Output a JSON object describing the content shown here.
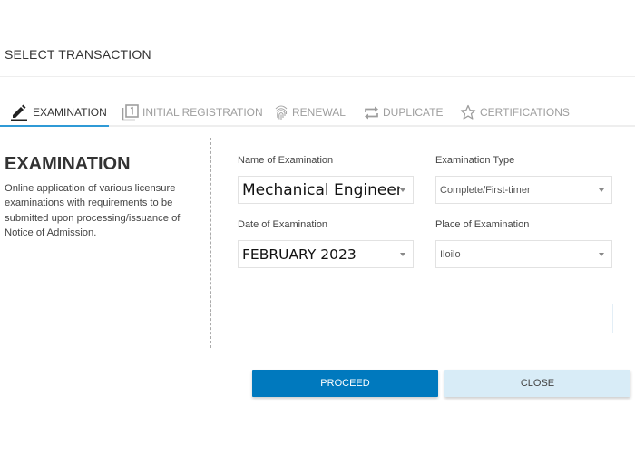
{
  "header": {
    "title": "SELECT TRANSACTION"
  },
  "tabs": [
    {
      "label": "EXAMINATION",
      "icon": "pencil-icon",
      "active": true
    },
    {
      "label": "INITIAL REGISTRATION",
      "icon": "filter-1-icon",
      "active": false
    },
    {
      "label": "RENEWAL",
      "icon": "fingerprint-icon",
      "active": false
    },
    {
      "label": "DUPLICATE",
      "icon": "repeat-icon",
      "active": false
    },
    {
      "label": "CERTIFICATIONS",
      "icon": "star-outline-icon",
      "active": false
    }
  ],
  "colors": {
    "accent": "#2f9ad6",
    "primary_button": "#0079be",
    "secondary_button": "#d8ecf7"
  },
  "section": {
    "title": "EXAMINATION",
    "description": "Online application of various licensure examinations with requirements to be submitted upon processing/issuance of Notice of Admission."
  },
  "form": {
    "name_of_examination": {
      "label": "Name of Examination",
      "value": "Mechanical Engineer"
    },
    "examination_type": {
      "label": "Examination Type",
      "value": "Complete/First-timer"
    },
    "date_of_examination": {
      "label": "Date of Examination",
      "value": "FEBRUARY 2023"
    },
    "place_of_examination": {
      "label": "Place of Examination",
      "value": "Iloilo"
    }
  },
  "actions": {
    "proceed_label": "PROCEED",
    "close_label": "CLOSE"
  }
}
